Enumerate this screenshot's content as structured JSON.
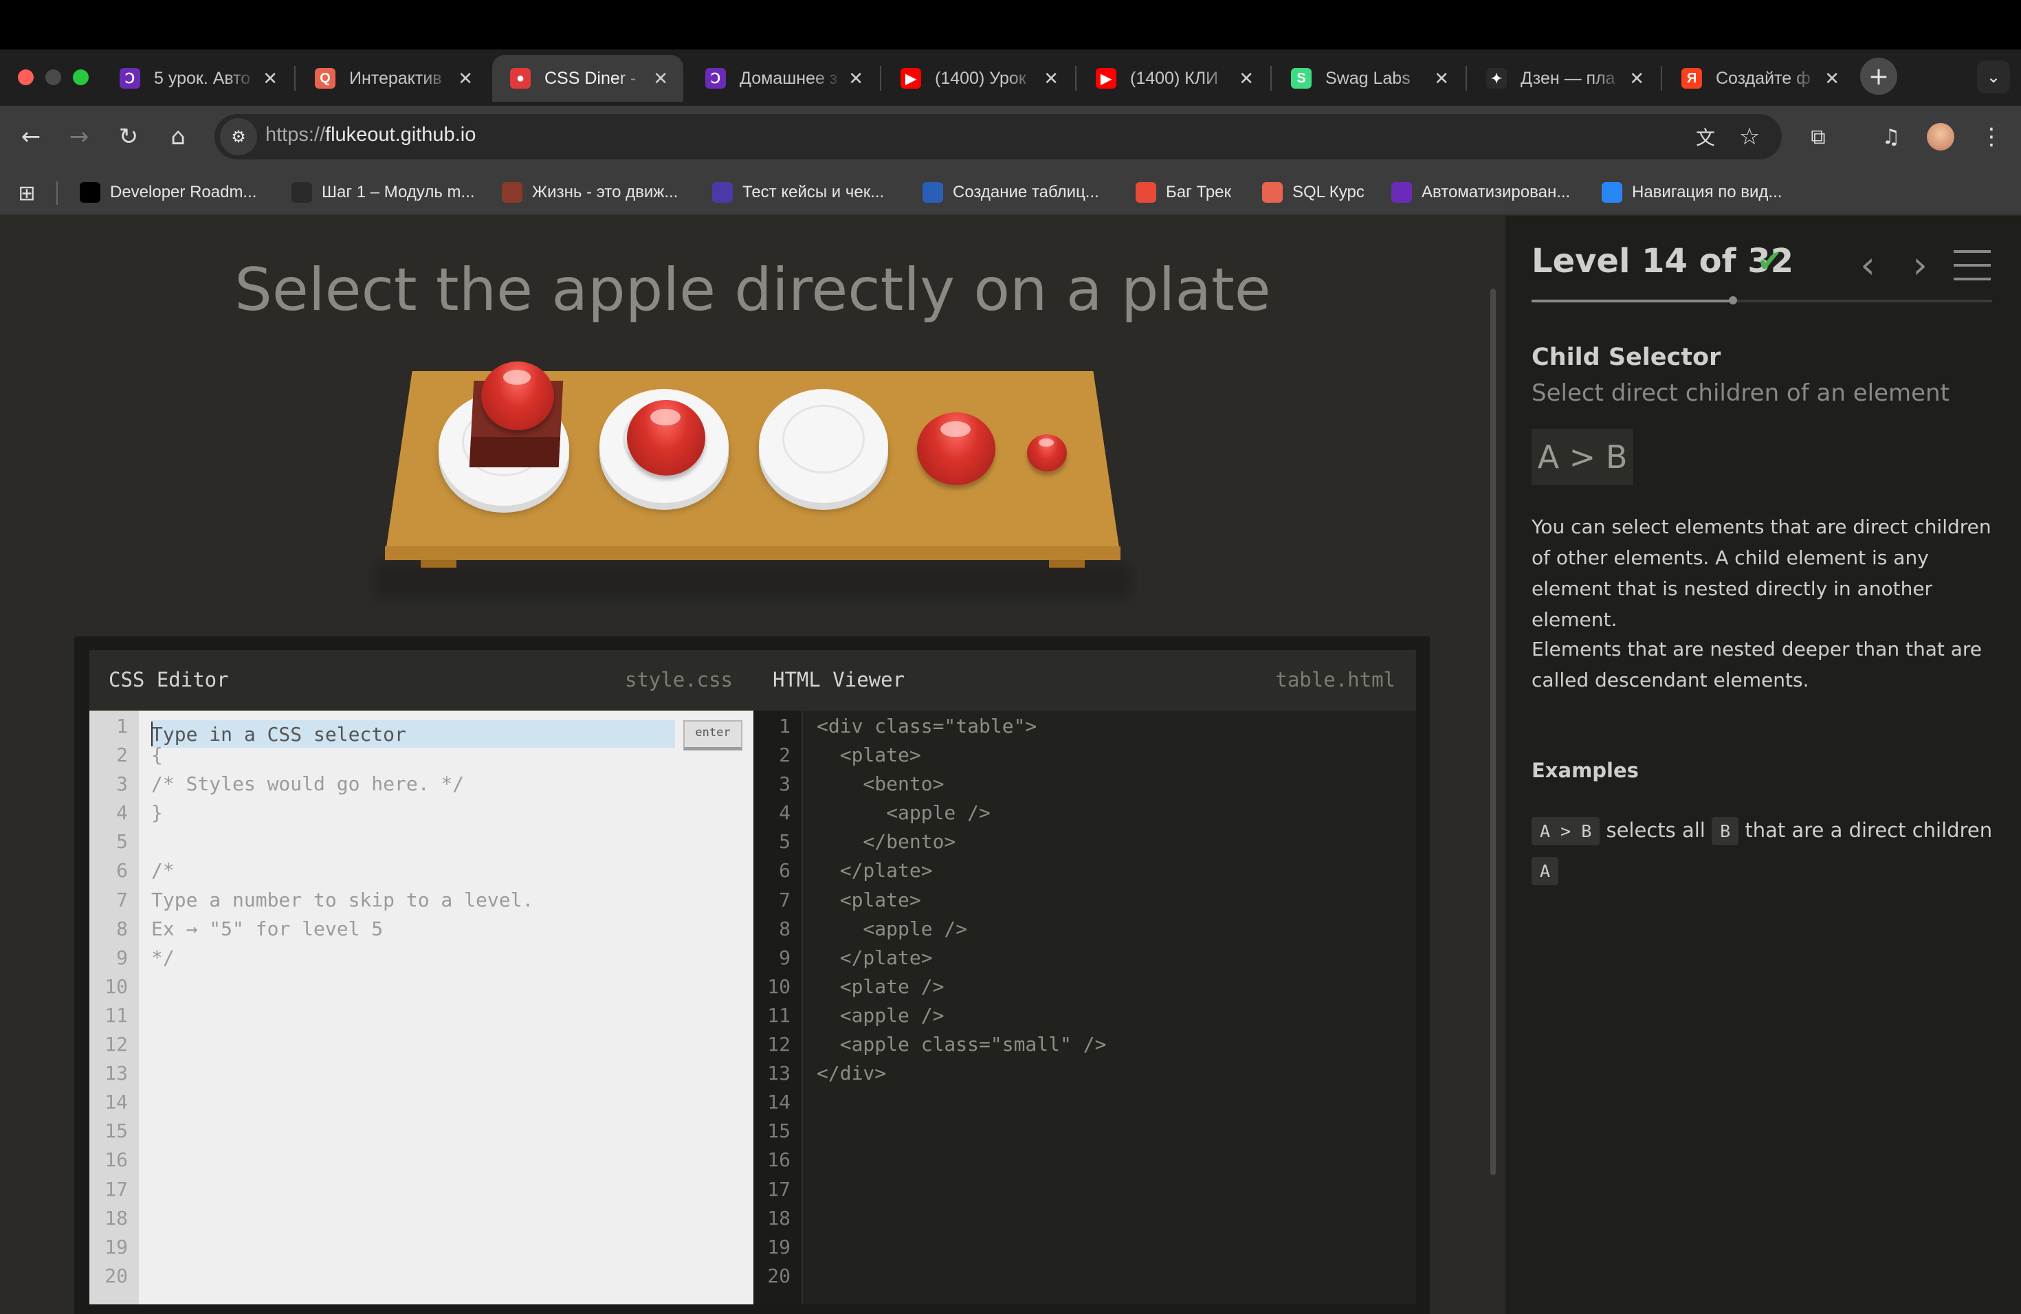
{
  "browser": {
    "tabs": [
      {
        "title": "5 урок. Авто",
        "icon": "p",
        "color": "#6b2bb8"
      },
      {
        "title": "Интерактив",
        "icon": "q",
        "color": "#e8644e"
      },
      {
        "title": "CSS Diner -",
        "icon": "o",
        "color": "#e03a3a"
      },
      {
        "title": "Домашнее з",
        "icon": "p",
        "color": "#6b2bb8"
      },
      {
        "title": "(1400) Урок",
        "icon": "yt",
        "color": "#ff0000"
      },
      {
        "title": "(1400) КЛИ",
        "icon": "yt",
        "color": "#ff0000"
      },
      {
        "title": "Swag Labs",
        "icon": "sl",
        "color": "#3ddc84"
      },
      {
        "title": "Дзен — пла",
        "icon": "star",
        "color": "#2a2a2a"
      },
      {
        "title": "Создайте ф",
        "icon": "ya",
        "color": "#fc3f1d"
      }
    ],
    "url_scheme": "https://",
    "url_host": "flukeout.github.io",
    "bookmarks": [
      {
        "label": "Developer Roadm...",
        "color": "#000000"
      },
      {
        "label": "Шаг 1 – Модуль m...",
        "color": "#2a2a2a"
      },
      {
        "label": "Жизнь - это движ...",
        "color": "#8a3a2a"
      },
      {
        "label": "Тест кейсы и чек...",
        "color": "#4a3aa8"
      },
      {
        "label": "Создание таблиц...",
        "color": "#2a5fb8"
      },
      {
        "label": "Баг Трек",
        "color": "#e84a3a"
      },
      {
        "label": "SQL Курс",
        "color": "#e8644e"
      },
      {
        "label": "Автоматизирован...",
        "color": "#6b2bb8"
      },
      {
        "label": "Навигация по вид...",
        "color": "#2787f5"
      }
    ]
  },
  "game": {
    "order": "Select the apple directly on a plate",
    "css_editor": {
      "label": "CSS Editor",
      "file": "style.css",
      "placeholder": "Type in a CSS selector",
      "enter_label": "enter",
      "lines": [
        "{",
        "/* Styles would go here. */",
        "}",
        "",
        "/*",
        "Type a number to skip to a level.",
        "Ex → \"5\" for level 5",
        "*/"
      ]
    },
    "html_viewer": {
      "label": "HTML Viewer",
      "file": "table.html",
      "lines": [
        "<div class=\"table\">",
        "  <plate>",
        "    <bento>",
        "      <apple />",
        "    </bento>",
        "  </plate>",
        "  <plate>",
        "    <apple />",
        "  </plate>",
        "  <plate />",
        "  <apple />",
        "  <apple class=\"small\" />",
        "</div>"
      ]
    },
    "line_numbers": [
      "1",
      "2",
      "3",
      "4",
      "5",
      "6",
      "7",
      "8",
      "9",
      "10",
      "11",
      "12",
      "13",
      "14",
      "15",
      "16",
      "17",
      "18",
      "19",
      "20"
    ]
  },
  "sidebar": {
    "level_text": "Level 14 of 32",
    "progress_fraction": 0.4375,
    "selector_name": "Child Selector",
    "selector_title": "Select direct children of an element",
    "syntax": "A > B",
    "hint_1": "You can select elements that are direct children of other elements. A child element is any element that is nested directly in another element.",
    "hint_2": "Elements that are nested deeper than that are called descendant elements.",
    "examples_heading": "Examples",
    "example": {
      "code_a": "A > B",
      "text_1": " selects all ",
      "code_b": "B",
      "text_2": " that are a direct children ",
      "code_c": "A"
    }
  }
}
